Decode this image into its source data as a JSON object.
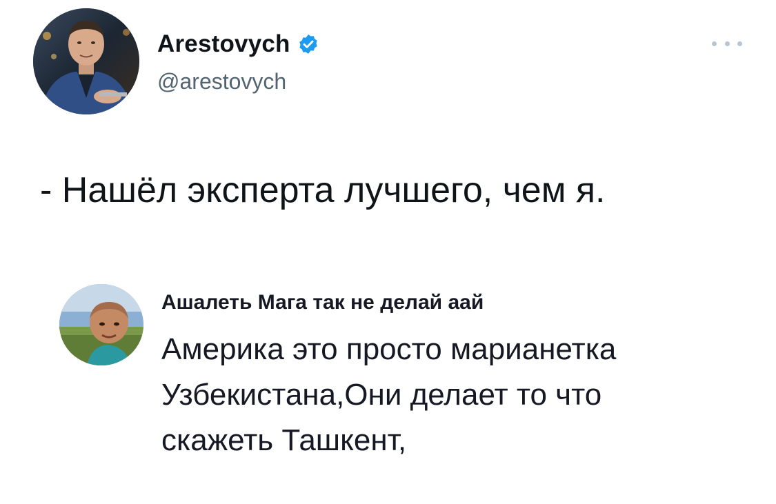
{
  "tweet": {
    "author": {
      "display_name": "Arestovych",
      "handle": "@arestovych",
      "verified": true
    },
    "more_icon": "more-horizontal-icon",
    "text": "- Нашёл эксперта лучшего, чем я."
  },
  "embedded_comment": {
    "author": "Ашалеть Мага так не делай аай",
    "lines": [
      "Америка это просто марианетка",
      "Узбекистана,Они делает то что",
      "скажеть Ташкент,"
    ]
  },
  "colors": {
    "primary_text": "#0f1419",
    "secondary_text": "#536471",
    "verified_badge": "#1d9bf0",
    "background": "#ffffff"
  }
}
